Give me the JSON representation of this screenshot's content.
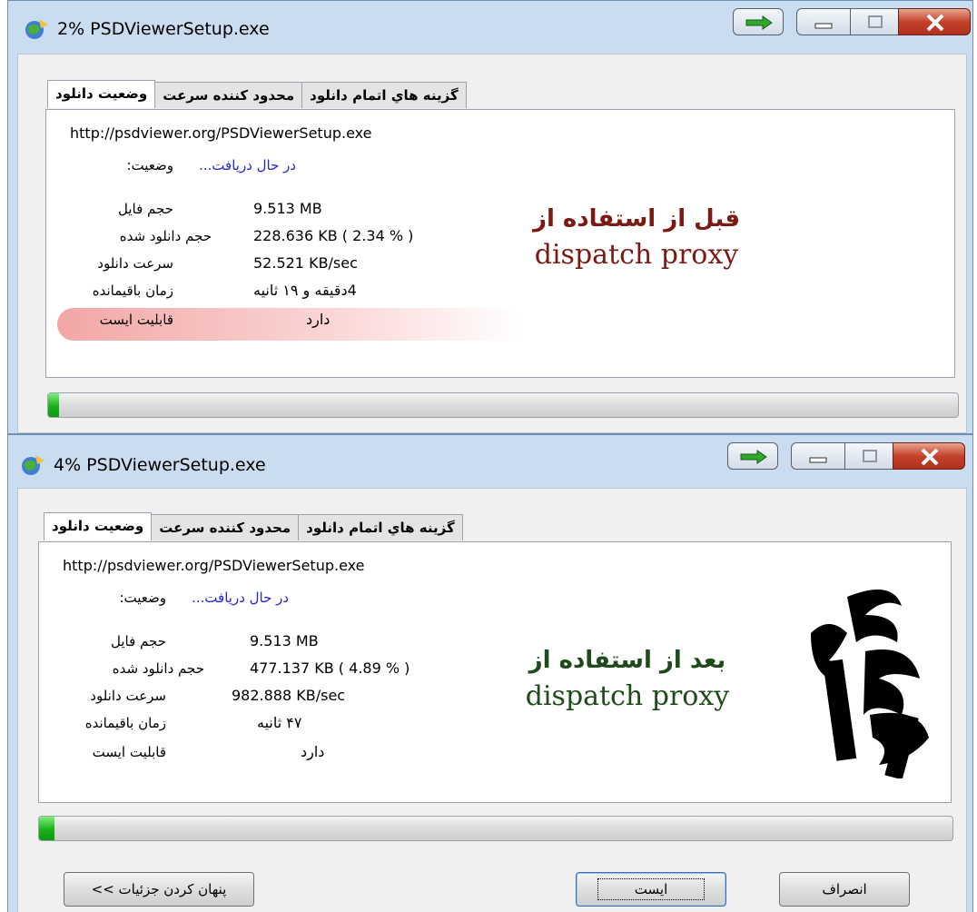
{
  "colors": {
    "title_bar": "#c9dcf0",
    "status_blue": "#2525d8",
    "caption_red": "#7a1a12",
    "caption_green": "#1f4a1a",
    "progress_green": "#19b01a",
    "close_red": "#c4422b",
    "highlight_pink": "#f09696"
  },
  "window_before": {
    "title": "2% PSDViewerSetup.exe",
    "app_icon": "globe-download-icon",
    "tabs": [
      "گزينه هاي اتمام دانلود",
      "محدود كننده سرعت",
      "وضعيت دانلود"
    ],
    "active_tab": "وضعيت دانلود",
    "url": "http://psdviewer.org/PSDViewerSetup.exe",
    "status_label": "وضعيت:",
    "status_value": "در حال دريافت...",
    "rows": [
      {
        "label": "حجم فايل",
        "value": "9.513  MB"
      },
      {
        "label": "حجم دانلود شده",
        "value": "228.636  KB  ( 2.34 % )"
      },
      {
        "label": "سرعت دانلود",
        "value": "52.521  KB/sec"
      },
      {
        "label": "زمان باقيمانده",
        "value": "4دقيقه و ١٩ ثانيه"
      },
      {
        "label": "قابليت ايست",
        "value": "دارد"
      }
    ],
    "caption_line1": "قبل از استفاده از",
    "caption_line2": "dispatch proxy",
    "progress": 0.0234
  },
  "window_after": {
    "title": "4% PSDViewerSetup.exe",
    "app_icon": "globe-download-icon",
    "tabs": [
      "گزينه هاي اتمام دانلود",
      "محدود كننده سرعت",
      "وضعيت دانلود"
    ],
    "active_tab": "وضعيت دانلود",
    "url": "http://psdviewer.org/PSDViewerSetup.exe",
    "status_label": "وضعيت:",
    "status_value": "در حال دريافت...",
    "rows": [
      {
        "label": "حجم فايل",
        "value": "9.513  MB"
      },
      {
        "label": "حجم دانلود شده",
        "value": "477.137  KB  ( 4.89 % )"
      },
      {
        "label": "سرعت دانلود",
        "value": "982.888  KB/sec"
      },
      {
        "label": "زمان باقيمانده",
        "value": "۴۷ ثانيه"
      },
      {
        "label": "قابليت ايست",
        "value": "دارد"
      }
    ],
    "caption_line1": "بعد از استفاده از",
    "caption_line2": "dispatch proxy",
    "logo": "calligraphy-logo",
    "progress": 0.0489,
    "buttons": {
      "hide_details": "پنهان كردن جزئيات >>",
      "pause": "ايست",
      "cancel": "انصراف"
    }
  }
}
